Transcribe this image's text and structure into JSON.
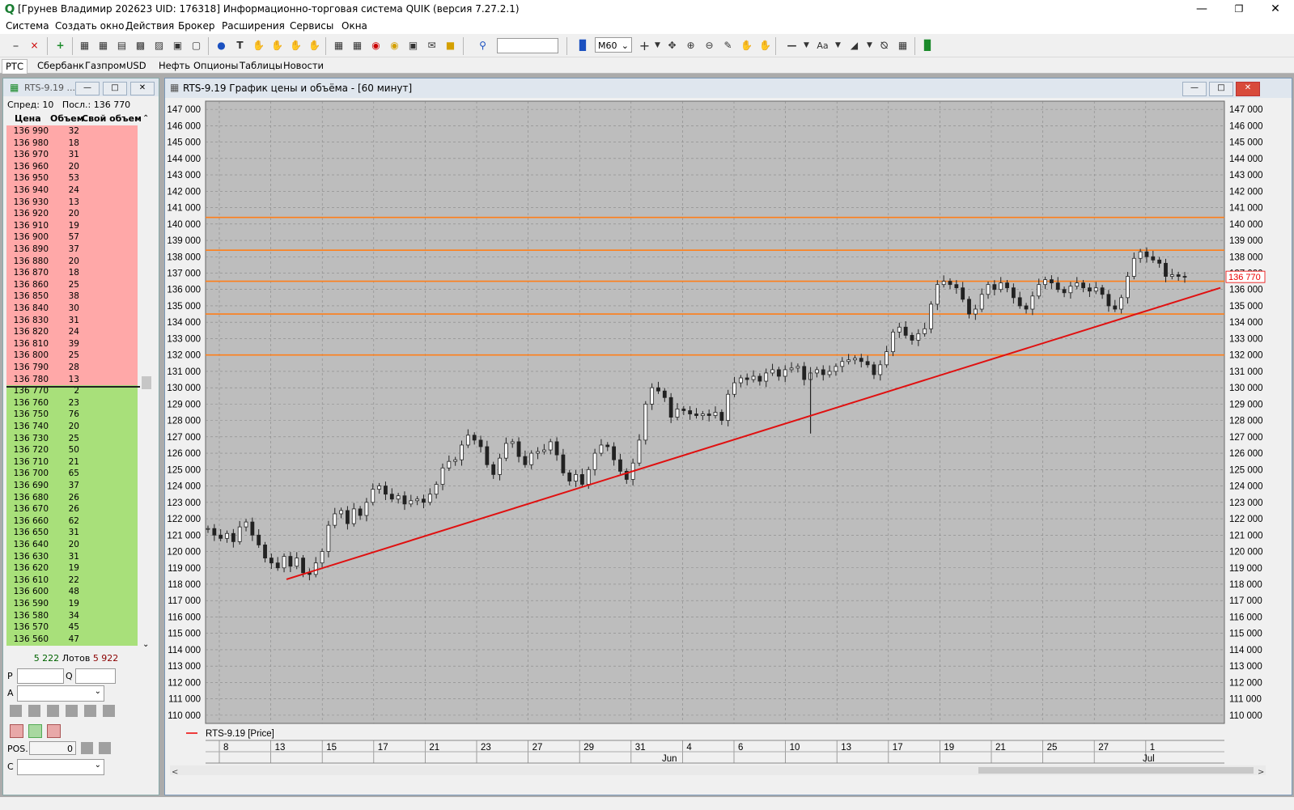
{
  "window": {
    "title": "[Грунев Владимир 202623 UID: 176318] Информационно-торговая система QUIK (версия 7.27.2.1)",
    "icon": "quik-logo-icon"
  },
  "menu": [
    "Система",
    "Создать окно",
    "Действия",
    "Брокер",
    "Расширения",
    "Сервисы",
    "Окна"
  ],
  "toolbar": {
    "interval_value": "M60",
    "search_value": ""
  },
  "tabs": [
    {
      "label": "РТС",
      "active": true
    },
    {
      "label": "Сбербанк"
    },
    {
      "label": "Газпром"
    },
    {
      "label": "USD"
    },
    {
      "label": "Нефть"
    },
    {
      "label": "Опционы"
    },
    {
      "label": "Таблицы"
    },
    {
      "label": "Новости"
    }
  ],
  "orderbook": {
    "title": "RTS-9.19 ...",
    "spread_text": "Спред: 10   Посл.: 136 770",
    "headers": {
      "price": "Цена",
      "volume": "Объем",
      "own": "Свой объем"
    },
    "asks": [
      [
        "136 990",
        "32"
      ],
      [
        "136 980",
        "18"
      ],
      [
        "136 970",
        "31"
      ],
      [
        "136 960",
        "20"
      ],
      [
        "136 950",
        "53"
      ],
      [
        "136 940",
        "24"
      ],
      [
        "136 930",
        "13"
      ],
      [
        "136 920",
        "20"
      ],
      [
        "136 910",
        "19"
      ],
      [
        "136 900",
        "57"
      ],
      [
        "136 890",
        "37"
      ],
      [
        "136 880",
        "20"
      ],
      [
        "136 870",
        "18"
      ],
      [
        "136 860",
        "25"
      ],
      [
        "136 850",
        "38"
      ],
      [
        "136 840",
        "30"
      ],
      [
        "136 830",
        "31"
      ],
      [
        "136 820",
        "24"
      ],
      [
        "136 810",
        "39"
      ],
      [
        "136 800",
        "25"
      ],
      [
        "136 790",
        "28"
      ],
      [
        "136 780",
        "13"
      ]
    ],
    "bids": [
      [
        "136 770",
        "2"
      ],
      [
        "136 760",
        "23"
      ],
      [
        "136 750",
        "76"
      ],
      [
        "136 740",
        "20"
      ],
      [
        "136 730",
        "25"
      ],
      [
        "136 720",
        "50"
      ],
      [
        "136 710",
        "21"
      ],
      [
        "136 700",
        "65"
      ],
      [
        "136 690",
        "37"
      ],
      [
        "136 680",
        "26"
      ],
      [
        "136 670",
        "26"
      ],
      [
        "136 660",
        "62"
      ],
      [
        "136 650",
        "31"
      ],
      [
        "136 640",
        "20"
      ],
      [
        "136 630",
        "31"
      ],
      [
        "136 620",
        "19"
      ],
      [
        "136 610",
        "22"
      ],
      [
        "136 600",
        "48"
      ],
      [
        "136 590",
        "19"
      ],
      [
        "136 580",
        "34"
      ],
      [
        "136 570",
        "45"
      ],
      [
        "136 560",
        "47"
      ]
    ],
    "totals": {
      "bid": "5 222",
      "label": "Лотов",
      "ask": "5 922"
    },
    "form": {
      "p_label": "P",
      "q_label": "Q",
      "a_label": "A",
      "pos_label": "POS.",
      "pos_value": "0",
      "c_label": "C"
    },
    "colors": {
      "ask": "#ffa8a8",
      "bid": "#a8e07a",
      "ask_text": "#8b0000",
      "bid_text": "#006400"
    }
  },
  "chart_window": {
    "title": "RTS-9.19 График цены и объёма - [60 минут]",
    "legend": "RTS-9.19 [Price]",
    "last_price_label": "136 770"
  },
  "chart_data": {
    "type": "candlestick",
    "instrument": "RTS-9.19",
    "interval": "60 минут",
    "y_ticks": [
      "147 000",
      "146 000",
      "145 000",
      "144 000",
      "143 000",
      "142 000",
      "141 000",
      "140 000",
      "139 000",
      "138 000",
      "137 000",
      "136 000",
      "135 000",
      "134 000",
      "133 000",
      "132 000",
      "131 000",
      "130 000",
      "129 000",
      "128 000",
      "127 000",
      "126 000",
      "125 000",
      "124 000",
      "123 000",
      "122 000",
      "121 000",
      "120 000",
      "119 000",
      "118 000",
      "117 000",
      "116 000",
      "115 000",
      "114 000",
      "113 000",
      "112 000",
      "111 000",
      "110 000"
    ],
    "ylim": [
      109500,
      147500
    ],
    "x_ticks": [
      "8",
      "13",
      "15",
      "17",
      "21",
      "23",
      "27",
      "29",
      "31",
      "4",
      "6",
      "10",
      "13",
      "17",
      "19",
      "21",
      "25",
      "27",
      "1"
    ],
    "x_months": [
      "Jun",
      "Jul"
    ],
    "horizontal_levels": [
      140400,
      138400,
      136500,
      134500,
      132000
    ],
    "trend_line": {
      "from": 118300,
      "to": 136100
    },
    "last_price": 136770,
    "close_path": [
      121400,
      121000,
      120800,
      121100,
      120600,
      121500,
      121800,
      121000,
      120400,
      119600,
      119300,
      119000,
      119700,
      119100,
      119600,
      118700,
      118600,
      119300,
      120000,
      121600,
      122300,
      122500,
      121700,
      122600,
      122200,
      123000,
      123800,
      124000,
      123500,
      123200,
      123400,
      122900,
      123100,
      123200,
      123000,
      123500,
      124100,
      125100,
      125500,
      125600,
      126500,
      127100,
      126800,
      126400,
      125300,
      124700,
      125700,
      126600,
      126700,
      125800,
      125300,
      126000,
      126100,
      126200,
      126700,
      125900,
      124800,
      124300,
      124700,
      124100,
      125000,
      126000,
      126500,
      126400,
      125600,
      124900,
      124400,
      125400,
      126800,
      129000,
      130000,
      129800,
      129400,
      128200,
      128700,
      128600,
      128400,
      128300,
      128400,
      128300,
      128500,
      128000,
      129600,
      130300,
      130600,
      130500,
      130700,
      130400,
      130900,
      131100,
      130700,
      131100,
      131200,
      131300,
      130500,
      130900,
      131100,
      130800,
      131000,
      131300,
      131600,
      131700,
      131800,
      131600,
      131400,
      130800,
      131400,
      132200,
      133400,
      133700,
      133200,
      132900,
      133300,
      133600,
      135100,
      136300,
      136500,
      136300,
      136100,
      135400,
      134500,
      134800,
      135700,
      136300,
      136000,
      136400,
      136100,
      135500,
      135000,
      134800,
      135600,
      136300,
      136600,
      136400,
      136000,
      135800,
      136200,
      136400,
      136100,
      135900,
      136100,
      135700,
      135000,
      134800,
      135500,
      136800,
      137900,
      138300,
      138000,
      137800,
      137600,
      136800,
      136900,
      136800,
      136770
    ],
    "spike_low": 127200
  }
}
